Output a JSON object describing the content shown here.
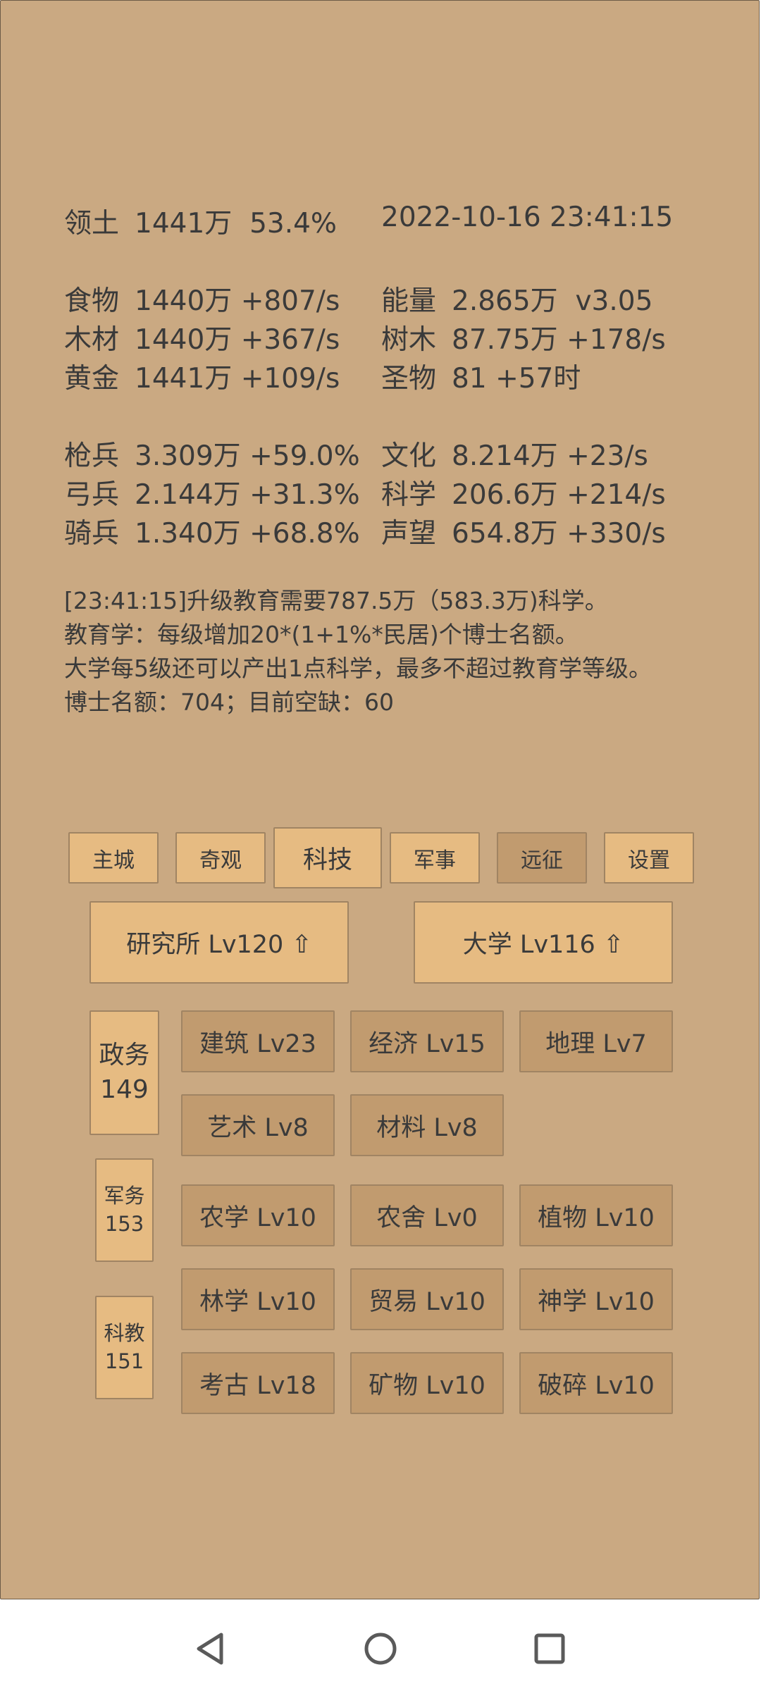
{
  "stats": {
    "territory": {
      "label": "领土",
      "value": "1441万",
      "extra": "53.4%"
    },
    "datetime": "2022-10-16 23:41:15",
    "food": {
      "label": "食物",
      "value": "1440万",
      "rate": "+807/s"
    },
    "energy": {
      "label": "能量",
      "value": "2.865万",
      "rate": "v3.05"
    },
    "wood": {
      "label": "木材",
      "value": "1440万",
      "rate": "+367/s"
    },
    "trees": {
      "label": "树木",
      "value": "87.75万",
      "rate": "+178/s"
    },
    "gold": {
      "label": "黄金",
      "value": "1441万",
      "rate": "+109/s"
    },
    "relic": {
      "label": "圣物",
      "value": "81",
      "rate": "+57时"
    },
    "spear": {
      "label": "枪兵",
      "value": "3.309万",
      "rate": "+59.0%"
    },
    "culture": {
      "label": "文化",
      "value": "8.214万",
      "rate": "+23/s"
    },
    "archer": {
      "label": "弓兵",
      "value": "2.144万",
      "rate": "+31.3%"
    },
    "science": {
      "label": "科学",
      "value": "206.6万",
      "rate": "+214/s"
    },
    "cavalry": {
      "label": "骑兵",
      "value": "1.340万",
      "rate": "+68.8%"
    },
    "prestige": {
      "label": "声望",
      "value": "654.8万",
      "rate": "+330/s"
    }
  },
  "log": [
    "[23:41:15]升级教育需要787.5万（583.3万)科学。",
    "教育学：每级增加20*(1+1%*民居)个博士名额。",
    "大学每5级还可以产出1点科学，最多不超过教育学等级。",
    "博士名额：704；目前空缺：60"
  ],
  "tabs": [
    {
      "label": "主城"
    },
    {
      "label": "奇观"
    },
    {
      "label": "科技"
    },
    {
      "label": "军事"
    },
    {
      "label": "远征"
    },
    {
      "label": "设置"
    }
  ],
  "buildings": {
    "institute": "研究所 Lv120 ⇧",
    "university": "大学 Lv116 ⇧"
  },
  "side": {
    "politics": {
      "name": "政务",
      "count": "149"
    },
    "military": {
      "name": "军务",
      "count": "153"
    },
    "science": {
      "name": "科教",
      "count": "151"
    }
  },
  "techs": {
    "architecture": "建筑 Lv23",
    "economy": "经济 Lv15",
    "geography": "地理 Lv7",
    "art": "艺术 Lv8",
    "materials": "材料 Lv8",
    "agronomy": "农学 Lv10",
    "farmhouse": "农舍 Lv0",
    "plants": "植物 Lv10",
    "forestry": "林学 Lv10",
    "trade": "贸易 Lv10",
    "theology": "神学 Lv10",
    "archaeology": "考古 Lv18",
    "minerals": "矿物 Lv10",
    "shatter": "破碎 Lv10"
  }
}
